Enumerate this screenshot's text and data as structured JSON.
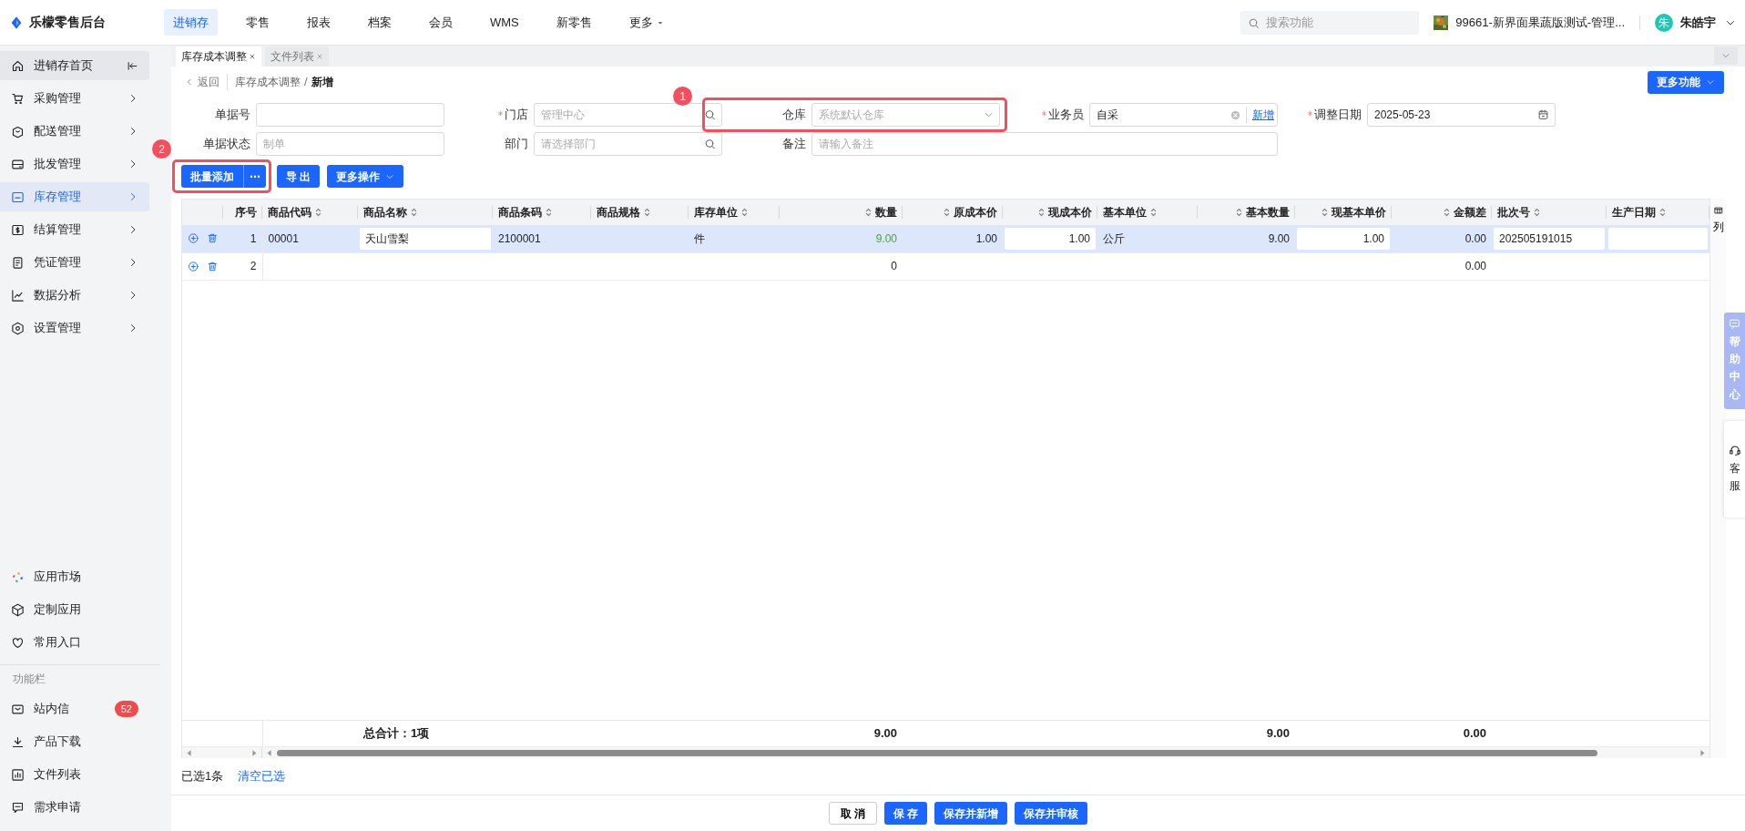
{
  "top_bar": {
    "logo": "乐檬零售后台",
    "menu": [
      {
        "label": "进销存",
        "selected": true,
        "dropdown": false
      },
      {
        "label": "零售",
        "selected": false,
        "dropdown": false
      },
      {
        "label": "报表",
        "selected": false,
        "dropdown": false
      },
      {
        "label": "档案",
        "selected": false,
        "dropdown": false
      },
      {
        "label": "会员",
        "selected": false,
        "dropdown": false
      },
      {
        "label": "WMS",
        "selected": false,
        "dropdown": false
      },
      {
        "label": "新零售",
        "selected": false,
        "dropdown": false
      },
      {
        "label": "更多",
        "selected": false,
        "dropdown": true
      }
    ],
    "search": {
      "placeholder": "搜索功能"
    },
    "store": "99661-新界面果蔬版测试-管理...",
    "user": {
      "avatar": "朱",
      "name": "朱皓宇"
    }
  },
  "sidebar": {
    "items": [
      {
        "label": "进销存首页",
        "selected": false,
        "expandable": false
      },
      {
        "label": "采购管理",
        "selected": false,
        "expandable": true
      },
      {
        "label": "配送管理",
        "selected": false,
        "expandable": true
      },
      {
        "label": "批发管理",
        "selected": false,
        "expandable": true
      },
      {
        "label": "库存管理",
        "selected": true,
        "expandable": true
      },
      {
        "label": "结算管理",
        "selected": false,
        "expandable": true
      },
      {
        "label": "凭证管理",
        "selected": false,
        "expandable": true
      },
      {
        "label": "数据分析",
        "selected": false,
        "expandable": true
      },
      {
        "label": "设置管理",
        "selected": false,
        "expandable": true
      }
    ],
    "apps": [
      {
        "label": "应用市场"
      },
      {
        "label": "定制应用"
      },
      {
        "label": "常用入口"
      }
    ],
    "section_label": "功能栏",
    "tools": [
      {
        "label": "站内信",
        "badge": "52"
      },
      {
        "label": "产品下载"
      },
      {
        "label": "文件列表"
      },
      {
        "label": "需求申请"
      }
    ]
  },
  "tabs": [
    {
      "label": "库存成本调整",
      "selected": true
    },
    {
      "label": "文件列表",
      "selected": false
    }
  ],
  "breadcrumb": {
    "back": "返回",
    "path": [
      "库存成本调整",
      "新增"
    ],
    "separator": "/"
  },
  "more_functions": "更多功能",
  "form": {
    "rows": [
      [
        {
          "label": "单据号",
          "required": false,
          "kind": "text"
        },
        {
          "label": "门店",
          "required": true,
          "kind": "search",
          "placeholder": "管理中心"
        },
        {
          "label": "仓库",
          "required": false,
          "kind": "select",
          "placeholder": "系统默认仓库"
        },
        {
          "label": "业务员",
          "required": true,
          "kind": "person",
          "value": "自采",
          "link": "新增"
        },
        {
          "label": "调整日期",
          "required": true,
          "kind": "date",
          "value": "2025-05-23"
        }
      ],
      [
        {
          "label": "单据状态",
          "required": false,
          "kind": "text",
          "placeholder": "制单"
        },
        {
          "label": "部门",
          "required": false,
          "kind": "search",
          "placeholder": "请选择部门"
        },
        {
          "label": "备注",
          "required": false,
          "kind": "wide",
          "placeholder": "请输入备注"
        }
      ]
    ]
  },
  "actions": {
    "batch_add": "批量添加",
    "batch_more": "⋯",
    "export": "导 出",
    "more_ops": "更多操作"
  },
  "annotations": [
    {
      "label": "1"
    },
    {
      "label": "2"
    }
  ],
  "table": {
    "columns": [
      {
        "label": "序号",
        "kind": "index"
      },
      {
        "label": "商品代码",
        "kind": "text"
      },
      {
        "label": "商品名称",
        "kind": "text",
        "total": "总合计：1项"
      },
      {
        "label": "商品条码",
        "kind": "text"
      },
      {
        "label": "商品规格",
        "kind": "text"
      },
      {
        "label": "库存单位",
        "kind": "text"
      },
      {
        "label": "数量",
        "kind": "number",
        "total": "9.00"
      },
      {
        "label": "原成本价",
        "kind": "number"
      },
      {
        "label": "现成本价",
        "kind": "number"
      },
      {
        "label": "基本单位",
        "kind": "text"
      },
      {
        "label": "基本数量",
        "kind": "number",
        "total": "9.00"
      },
      {
        "label": "现基本单价",
        "kind": "number"
      },
      {
        "label": "金额差",
        "kind": "number",
        "total": "0.00"
      },
      {
        "label": "批次号",
        "kind": "text"
      },
      {
        "label": "生产日期",
        "kind": "text"
      }
    ],
    "rows": [
      {
        "selected": true,
        "cells": [
          "1",
          "00001",
          {
            "kind": "input",
            "text": "天山雪梨"
          },
          "2100001",
          "",
          "件",
          {
            "kind": "highlight",
            "text": "9.00"
          },
          "1.00",
          {
            "kind": "input",
            "text": "1.00"
          },
          "公斤",
          "9.00",
          {
            "kind": "input",
            "text": "1.00"
          },
          "0.00",
          {
            "kind": "input",
            "text": "202505191015"
          },
          {
            "kind": "input"
          }
        ]
      },
      {
        "selected": false,
        "cells": [
          "2",
          "",
          "",
          "",
          "",
          "",
          "0",
          "",
          "",
          "",
          "",
          "",
          "0.00",
          "",
          ""
        ]
      }
    ],
    "column_settings": "列"
  },
  "selection": {
    "summary": "已选1条",
    "clear": "清空已选"
  },
  "footer_buttons": [
    {
      "label": "取 消",
      "kind": "secondary"
    },
    {
      "label": "保 存",
      "kind": "primary"
    },
    {
      "label": "保存并新增",
      "kind": "primary"
    },
    {
      "label": "保存并审核",
      "kind": "primary"
    }
  ],
  "side_panels": {
    "help": "帮助中心",
    "service": "客服"
  }
}
